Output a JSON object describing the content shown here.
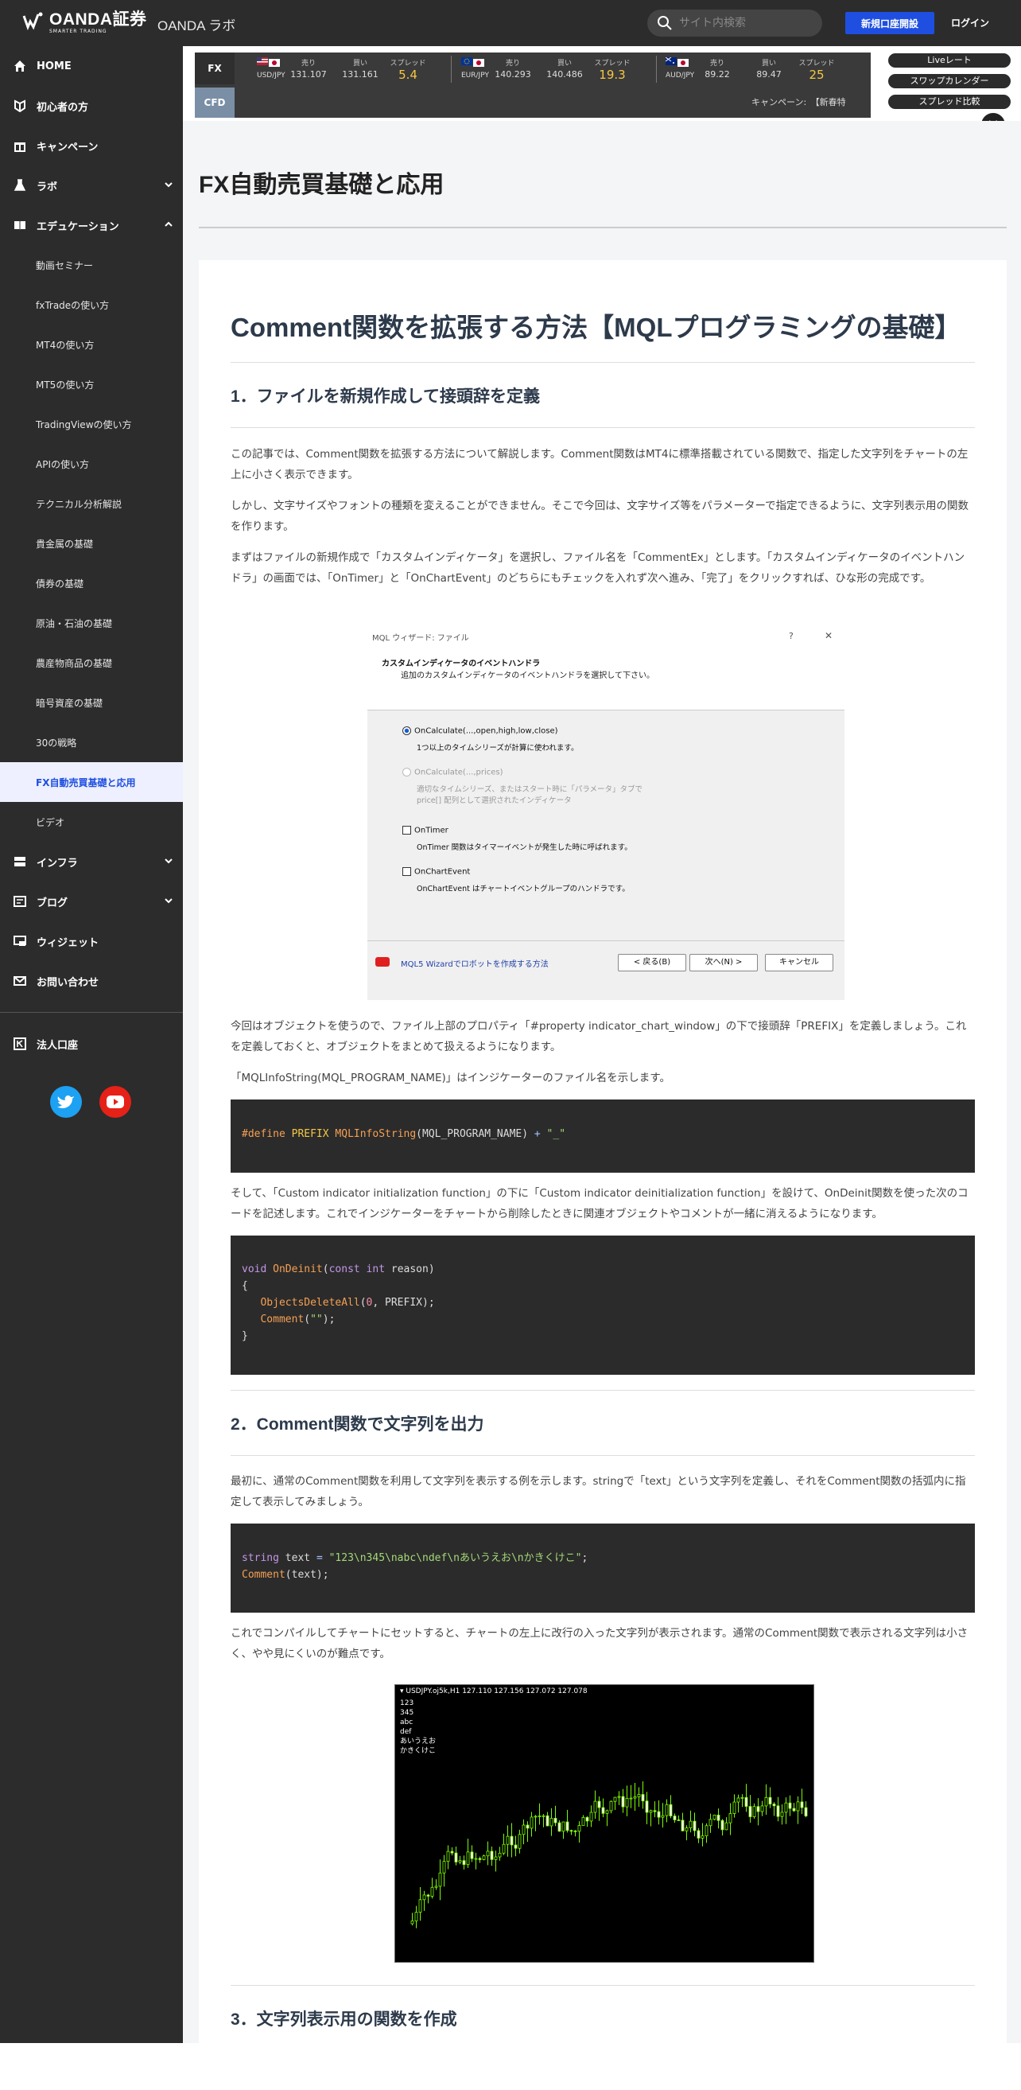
{
  "header": {
    "brand": "OANDA証券",
    "tagline": "SMARTER TRADING",
    "lab_title": "OANDA ラボ",
    "search_placeholder": "サイト内検索",
    "open_account": "新規口座開設",
    "login": "ログイン"
  },
  "sidebar": {
    "items": [
      {
        "label": "HOME",
        "icon": "home-icon"
      },
      {
        "label": "初心者の方",
        "icon": "beginner-mark-icon"
      },
      {
        "label": "キャンペーン",
        "icon": "gift-icon"
      },
      {
        "label": "ラボ",
        "icon": "flask-icon"
      },
      {
        "label": "エデュケーション",
        "icon": "book-icon"
      }
    ],
    "sub_items": [
      "動画セミナー",
      "fxTradeの使い方",
      "MT4の使い方",
      "MT5の使い方",
      "TradingViewの使い方",
      "APIの使い方",
      "テクニカル分析解説",
      "貴金属の基礎",
      "債券の基礎",
      "原油・石油の基礎",
      "農産物商品の基礎",
      "暗号資産の基礎",
      "30の戦略",
      "FX自動売買基礎と応用",
      "ビデオ"
    ],
    "lower_items": [
      {
        "label": "インフラ",
        "icon": "server-icon"
      },
      {
        "label": "ブログ",
        "icon": "blog-icon"
      },
      {
        "label": "ウィジェット",
        "icon": "widget-icon"
      },
      {
        "label": "お問い合わせ",
        "icon": "mail-icon"
      }
    ],
    "corporate": {
      "label": "法人口座",
      "icon": "corporate-icon"
    }
  },
  "ticker": {
    "fx_tab": "FX",
    "cfd_tab": "CFD",
    "pairs": [
      {
        "name": "USD/JPY",
        "sell_label": "売り",
        "sell": "131.107",
        "buy_label": "買い",
        "buy": "131.161",
        "spread_label": "スプレッド",
        "spread": "5.4"
      },
      {
        "name": "EUR/JPY",
        "sell_label": "売り",
        "sell": "140.293",
        "buy_label": "買い",
        "buy": "140.486",
        "spread_label": "スプレッド",
        "spread": "19.3"
      },
      {
        "name": "AUD/JPY",
        "sell_label": "売り",
        "sell": "89.22",
        "buy_label": "買い",
        "buy": "89.47",
        "spread_label": "スプレッド",
        "spread": "25"
      }
    ],
    "campaign": "キャンペーン:　【新春特",
    "buttons": [
      "Liveレート",
      "スワップカレンダー",
      "スプレッド比較"
    ]
  },
  "page": {
    "title": "FX自動売買基礎と応用"
  },
  "article": {
    "h1": "Comment関数を拡張する方法【MQLプログラミングの基礎】",
    "s1_title": "1．ファイルを新規作成して接頭辞を定義",
    "p1": "この記事では、Comment関数を拡張する方法について解説します。Comment関数はMT4に標準搭載されている関数で、指定した文字列をチャートの左上に小さく表示できます。",
    "p2": "しかし、文字サイズやフォントの種類を変えることができません。そこで今回は、文字サイズ等をパラメーターで指定できるように、文字列表示用の関数を作ります。",
    "p3": "まずはファイルの新規作成で「カスタムインディケータ」を選択し、ファイル名を「CommentEx」とします。「カスタムインディケータのイベントハンドラ」の画面では、「OnTimer」と「OnChartEvent」のどちらにもチェックを入れず次へ進み、「完了」をクリックすれば、ひな形の完成です。",
    "wizard": {
      "title": "MQL ウィザード: ファイル",
      "help": "?",
      "close": "✕",
      "heading": "カスタムインディケータのイベントハンドラ",
      "subheading": "追加のカスタムインディケータのイベントハンドラを選択して下さい。",
      "opt1": "OnCalculate(...,open,high,low,close)",
      "opt1_desc": "1つ以上のタイムシリーズが計算に使われます。",
      "opt2": "OnCalculate(...,prices)",
      "opt2_desc1": "適切なタイムシリーズ、またはスタート時に「パラメータ」タブで",
      "opt2_desc2": "price[] 配列として選択されたインディケータ",
      "opt3": "OnTimer",
      "opt3_desc": "OnTimer 関数はタイマーイベントが発生した時に呼ばれます。",
      "opt4": "OnChartEvent",
      "opt4_desc": "OnChartEvent はチャートイベントグループのハンドラです。",
      "footer_link": "MQL5 Wizardでロボットを作成する方法",
      "back": "< 戻る(B)",
      "next": "次へ(N) >",
      "cancel": "キャンセル"
    },
    "p4": "今回はオブジェクトを使うので、ファイル上部のプロパティ「#property indicator_chart_window」の下で接頭辞「PREFIX」を定義しましょう。これを定義しておくと、オブジェクトをまとめて扱えるようになります。",
    "p5": "「MQLInfoString(MQL_PROGRAM_NAME)」はインジケーターのファイル名を示します。",
    "code1": {
      "a": "#define ",
      "b": "PREFIX ",
      "c": "MQLInfoString",
      "d": "(MQL_PROGRAM_NAME) ",
      "e": "+ ",
      "f": "\"_\""
    },
    "p6": "そして、「Custom indicator initialization function」の下に「Custom indicator deinitialization function」を設けて、OnDeinit関数を使った次のコードを記述します。これでインジケーターをチャートから削除したときに関連オブジェクトやコメントが一緒に消えるようになります。",
    "code2": {
      "l1a": "void ",
      "l1b": "OnDeinit",
      "l1c": "(",
      "l1d": "const int ",
      "l1e": "reason)",
      "l2": "{",
      "l3a": "   ObjectsDeleteAll",
      "l3b": "(",
      "l3c": "0",
      "l3d": ", PREFIX);",
      "l4a": "   Comment",
      "l4b": "(",
      "l4c": "\"\"",
      "l4d": ");",
      "l5": "}"
    },
    "s2_title": "2．Comment関数で文字列を出力",
    "p7": "最初に、通常のComment関数を利用して文字列を表示する例を示します。stringで「text」という文字列を定義し、それをComment関数の括弧内に指定して表示してみましょう。",
    "code3": {
      "l1a": "string ",
      "l1b": "text ",
      "l1c": "= ",
      "l1d": "\"123\\n345\\nabc\\ndef\\nあいうえお\\nかきくけこ\"",
      "l1e": ";",
      "l2a": "Comment",
      "l2b": "(text);"
    },
    "p8": "これでコンパイルしてチャートにセットすると、チャートの左上に改行の入った文字列が表示されます。通常のComment関数で表示される文字列は小さく、やや見にくいのが難点です。",
    "chart_image": {
      "title": "▾ USDJPY.oj5k,H1  127.110 127.156 127.072 127.078",
      "lines": "123\n345\nabc\ndef\nあいうえお\nかきくけこ"
    },
    "s3_title": "3．文字列表示用の関数を作成"
  },
  "colors": {
    "dark": "#2c2c2c",
    "accent": "#1f4fe0",
    "spread": "#f6c744",
    "heading": "#2d3a4b"
  }
}
